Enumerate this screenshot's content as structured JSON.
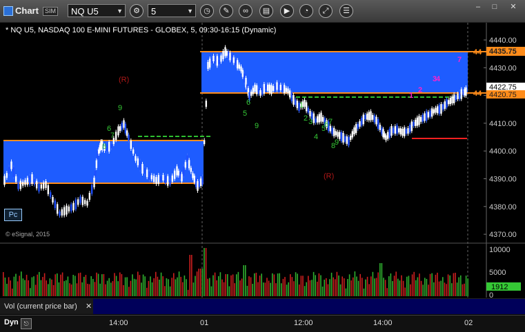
{
  "window": {
    "title": "Chart",
    "sim_badge": "SIM",
    "symbol": "NQ U5",
    "interval": "5",
    "minimize": "–",
    "maximize": "□",
    "close": "✕"
  },
  "chart": {
    "title": "* NQ U5, NASDAQ 100 E-MINI FUTURES - GLOBEX, 5, 09:30-16:15 (Dynamic)",
    "copyright": "© eSignal, 2015",
    "pc_label": "Pc",
    "price_ticks": [
      "4440.00",
      "4430.00",
      "4420.00",
      "4410.00",
      "4400.00",
      "4390.00",
      "4380.00",
      "4370.00"
    ],
    "last_price": "4422.75",
    "level_high": "4435.75",
    "level_low": "4420.75",
    "level_high_clipped": "44",
    "level_low_clipped": "44",
    "r_markers": [
      "(R)",
      "(R)"
    ],
    "seq_numbers": [
      "9",
      "6",
      "7",
      "8",
      "5",
      "6",
      "9",
      "1",
      "2",
      "3",
      "4",
      "5",
      "6",
      "7",
      "8",
      "9"
    ],
    "magenta_numbers": [
      "1",
      "2",
      "3",
      "4",
      "7"
    ],
    "colors": {
      "zone": "#1e5cff",
      "level": "#ff8c1a",
      "up": "#ffffff",
      "down": "#1f4fff",
      "red": "#ff2020",
      "seq": "#35c835",
      "magenta": "#ff22cc"
    }
  },
  "volume": {
    "label": "Vol (current price bar)",
    "close": "✕",
    "ticks": [
      "10000",
      "5000",
      "0"
    ],
    "current": "1912"
  },
  "timeline": {
    "dyn_label": "Dyn",
    "labels": [
      "14:00",
      "01",
      "12:00",
      "14:00",
      "02"
    ]
  }
}
